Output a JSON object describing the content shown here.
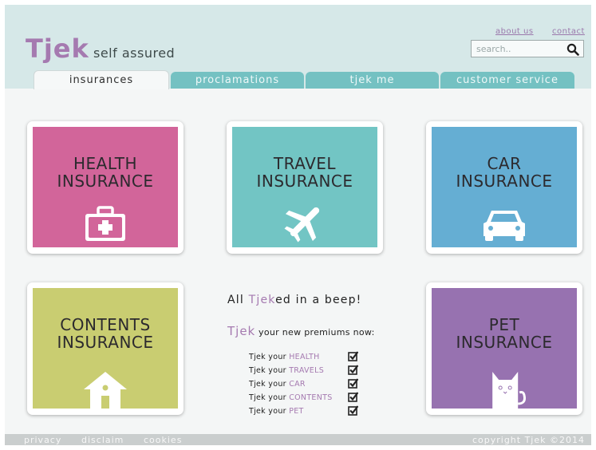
{
  "brand": {
    "logo": "Tjek",
    "tagline": "self assured"
  },
  "header": {
    "links": {
      "about": "about us",
      "contact": "contact"
    },
    "search": {
      "placeholder": "search.."
    }
  },
  "tabs": [
    {
      "label": "insurances",
      "active": true
    },
    {
      "label": "proclamations",
      "active": false
    },
    {
      "label": "tjek me",
      "active": false
    },
    {
      "label": "customer service",
      "active": false
    }
  ],
  "cards": [
    {
      "line1": "HEALTH",
      "line2": "INSURANCE",
      "color": "#d2659a",
      "icon": "first-aid-kit-icon"
    },
    {
      "line1": "TRAVEL",
      "line2": "INSURANCE",
      "color": "#72c5c4",
      "icon": "airplane-icon"
    },
    {
      "line1": "CAR",
      "line2": "INSURANCE",
      "color": "#65aed3",
      "icon": "car-icon"
    },
    {
      "line1": "CONTENTS",
      "line2": "INSURANCE",
      "color": "#c9cd71",
      "icon": "house-icon"
    },
    {
      "line1": "PET",
      "line2": "INSURANCE",
      "color": "#9772b0",
      "icon": "cat-icon"
    }
  ],
  "promo": {
    "headline": {
      "pre": "All ",
      "accent": "Tjek",
      "post": "ed in a beep!"
    },
    "sub": {
      "accent": "Tjek",
      "rest": " your new premiums now:"
    },
    "checklist": [
      {
        "prefix": "Tjek your ",
        "item": "HEALTH"
      },
      {
        "prefix": "Tjek your ",
        "item": "TRAVELS"
      },
      {
        "prefix": "Tjek your ",
        "item": "CAR"
      },
      {
        "prefix": "Tjek your ",
        "item": "CONTENTS"
      },
      {
        "prefix": "Tjek your ",
        "item": "PET"
      }
    ]
  },
  "footer": {
    "links": [
      "privacy",
      "disclaim",
      "cookies"
    ],
    "copyright": "copyright Tjek ©2014"
  },
  "colors": {
    "accent": "#a57ab0",
    "teal": "#74c1c2",
    "header_bg": "#d6e8e8"
  }
}
